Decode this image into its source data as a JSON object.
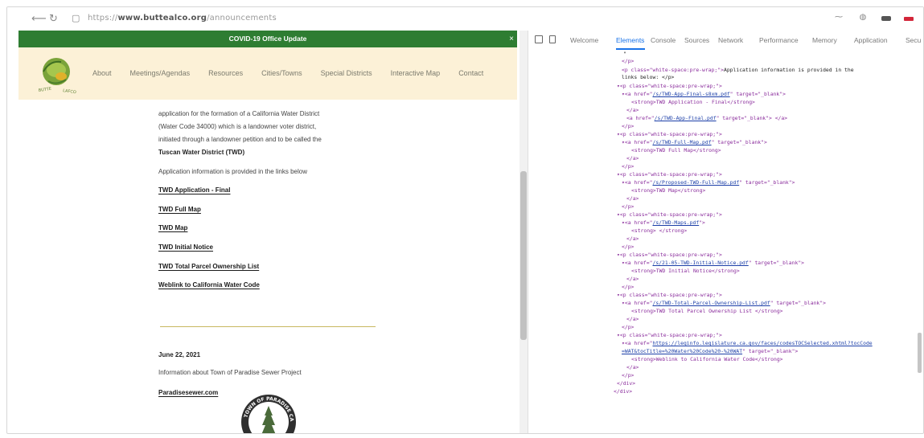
{
  "browser": {
    "url_prefix": "https://",
    "url_domain": "www.buttealco.org",
    "url_path": "/announcements"
  },
  "site": {
    "banner": "COVID-19 Office Update",
    "banner_close": "×",
    "nav": [
      "About",
      "Meetings/Agendas",
      "Resources",
      "Cities/Towns",
      "Special Districts",
      "Interactive Map",
      "Contact"
    ],
    "logo_text": "BUTTE LAFCO",
    "content": {
      "line1": "application for the formation of a California Water District",
      "line2": "(Water Code 34000) which is a landowner voter district,",
      "line3": "initiated through a landowner petition and to be called the",
      "district_name": "Tuscan Water District (TWD)",
      "info": "Application information is provided in the links below",
      "links": [
        "TWD Application - Final",
        "TWD Full Map",
        "TWD Map",
        "TWD Initial Notice",
        "TWD Total Parcel Ownership List",
        "Weblink to California Water Code"
      ],
      "date": "June 22, 2021",
      "sewer_text": "Information about Town of Paradise Sewer Project",
      "sewer_link": "Paradisesewer.com",
      "seal_text": "TOWN OF PARADISE CALIFORNIA"
    }
  },
  "devtools": {
    "welcome": "Welcome",
    "tabs": [
      "Elements",
      "Console",
      "Sources",
      "Network",
      "Performance",
      "Memory",
      "Application",
      "Secu"
    ],
    "active_tab": "Elements",
    "code": {
      "l0": "\"",
      "p_close": "</p>",
      "p_open_pre": "<p class=\"white-space:pre-wrap;\">",
      "p_open_pre_arrow": "▾<p class=\"white-space:pre-wrap;\">",
      "app_info_a": "Application information is provided in the",
      "app_info_b": "links below: </p>",
      "a1_href": "/s/TWD-App-Final-s8xm.pdf",
      "a_open_arrow": "▾<a href=\"",
      "a_open": "<a href=\"",
      "target_blank": "\" target=\"_blank\">",
      "target_blank_close": "\" target=\"_blank\"> </a>",
      "strong1": "<strong>TWD Application - Final</strong>",
      "a_close": "</a>",
      "a2_href": "/s/TWD-App-Final.pdf",
      "a3_href": "/s/TWD-Full-Map.pdf",
      "strong3": "<strong>TWD Full Map</strong>",
      "a4_href": "/s/Proposed-TWD-Full-Map.pdf",
      "strong4": "<strong>TWD Map</strong>",
      "a5_href": "/s/TWD-Maps.pdf",
      "strong5": "<strong> </strong>",
      "a6_href": "/s/21-05-TWD-Initial-Notice.pdf",
      "strong6": "<strong>TWD Initial Notice</strong>",
      "a7_href": "/s/TWD-Total-Parcel-Ownership-List.pdf",
      "strong7": "<strong>TWD Total Parcel Ownership List </strong>",
      "a8_href_1": "https://leginfo.legislature.ca.gov/faces/codesTOCSelected.xhtml?tocCode",
      "a8_href_2": "=WAT&tocTitle=%20Water%20Code%20-%20WAT",
      "strong8": "<strong>Weblink to California Water Code</strong>",
      "div_close": "</div>",
      "a5_close": "\">"
    }
  },
  "colors": {
    "banner_green": "#2e7d32",
    "nav_bg": "#fcf1d7",
    "devtools_active": "#1a73e8",
    "tag_color": "#8a2c9c",
    "attr_color": "#b5511e",
    "value_color": "#1c3fa8"
  },
  "icons": [
    "reload-icon",
    "page-info-icon",
    "inspect-icon",
    "device-toggle-icon",
    "close-icon"
  ]
}
